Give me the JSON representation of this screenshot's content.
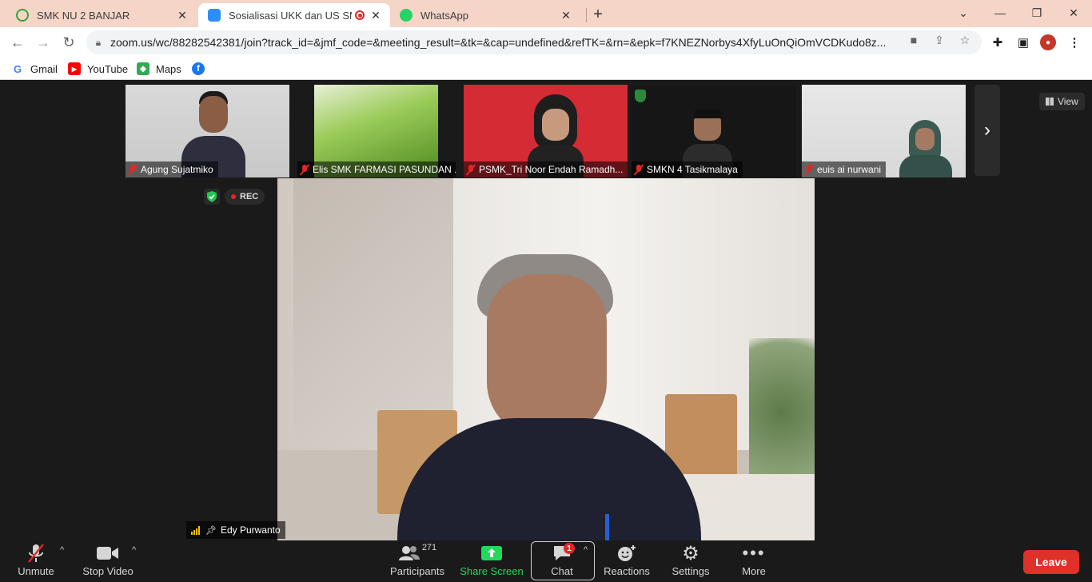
{
  "browser": {
    "tabs": [
      {
        "title": "SMK NU 2 BANJAR",
        "favicon": "smk-logo-icon",
        "active": false
      },
      {
        "title": "Sosialisasi UKK dan US SMK",
        "favicon": "zoom-icon",
        "active": true
      },
      {
        "title": "WhatsApp",
        "favicon": "whatsapp-icon",
        "active": false
      }
    ],
    "url": "zoom.us/wc/88282542381/join?track_id=&jmf_code=&meeting_result=&tk=&cap=undefined&refTK=&rn=&epk=f7KNEZNorbys4XfyLuOnQiOmVCDKudo8z...",
    "bookmarks": [
      {
        "label": "Gmail",
        "icon": "google-icon"
      },
      {
        "label": "YouTube",
        "icon": "youtube-icon"
      },
      {
        "label": "Maps",
        "icon": "maps-icon"
      },
      {
        "label": "",
        "icon": "facebook-icon"
      }
    ]
  },
  "meeting": {
    "participants_strip": [
      {
        "name": "Agung Sujatmiko",
        "muted": true
      },
      {
        "name": "Elis SMK FARMASI PASUNDAN ...",
        "muted": true
      },
      {
        "name": "PSMK_Tri Noor Endah Ramadh...",
        "muted": true
      },
      {
        "name": "SMKN 4 Tasikmalaya",
        "muted": true
      },
      {
        "name": "euis ai nurwani",
        "muted": true
      }
    ],
    "view_label": "View",
    "rec_label": "REC",
    "active_speaker": "Edy Purwanto"
  },
  "controls": {
    "unmute": "Unmute",
    "stop_video": "Stop Video",
    "participants": "Participants",
    "participants_count": "271",
    "share_screen": "Share Screen",
    "chat": "Chat",
    "chat_badge": "1",
    "reactions": "Reactions",
    "settings": "Settings",
    "more": "More",
    "leave": "Leave"
  },
  "colors": {
    "tabstrip": "#f5d5c8",
    "leave": "#e0302a",
    "share_screen": "#23d959",
    "muted": "#e02828"
  }
}
